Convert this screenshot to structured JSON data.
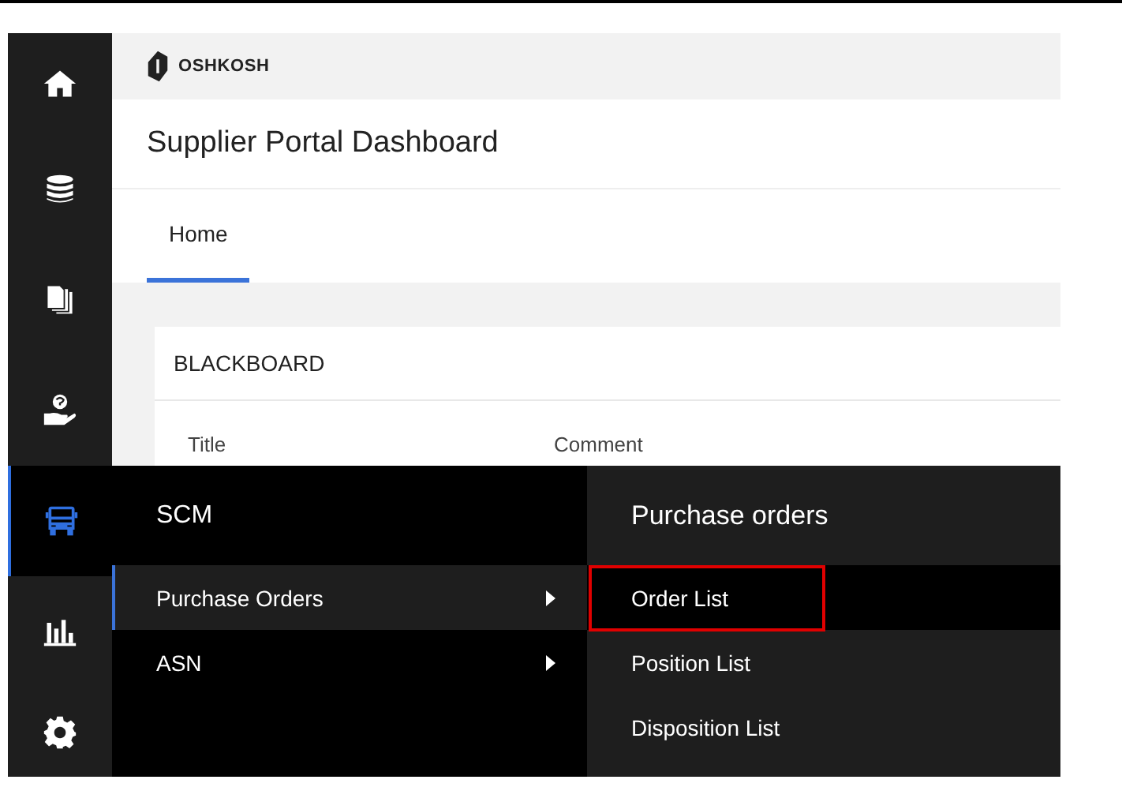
{
  "sidebar": {
    "items": [
      {
        "kind": "home",
        "selected": false
      },
      {
        "kind": "database",
        "selected": false
      },
      {
        "kind": "documents",
        "selected": false
      },
      {
        "kind": "support",
        "selected": false
      },
      {
        "kind": "truck",
        "selected": true
      },
      {
        "kind": "chart",
        "selected": false
      },
      {
        "kind": "settings",
        "selected": false
      }
    ]
  },
  "header": {
    "logo": "OSHKOSH"
  },
  "page_title": "Supplier Portal Dashboard",
  "tabs": [
    {
      "label": "Home",
      "selected": true
    }
  ],
  "blackboard": {
    "title": "BLACKBOARD",
    "columns": [
      "Title",
      "Comment"
    ]
  },
  "menu": {
    "title": "SCM",
    "items": [
      {
        "label": "Purchase Orders",
        "selected": true,
        "has_submenu": true
      },
      {
        "label": "ASN",
        "selected": false,
        "has_submenu": true
      }
    ]
  },
  "submenu": {
    "title": "Purchase orders",
    "items": [
      {
        "label": "Order List",
        "selected": true,
        "highlighted": true
      },
      {
        "label": "Position List",
        "selected": false,
        "highlighted": false
      },
      {
        "label": "Disposition List",
        "selected": false,
        "highlighted": false
      }
    ]
  }
}
